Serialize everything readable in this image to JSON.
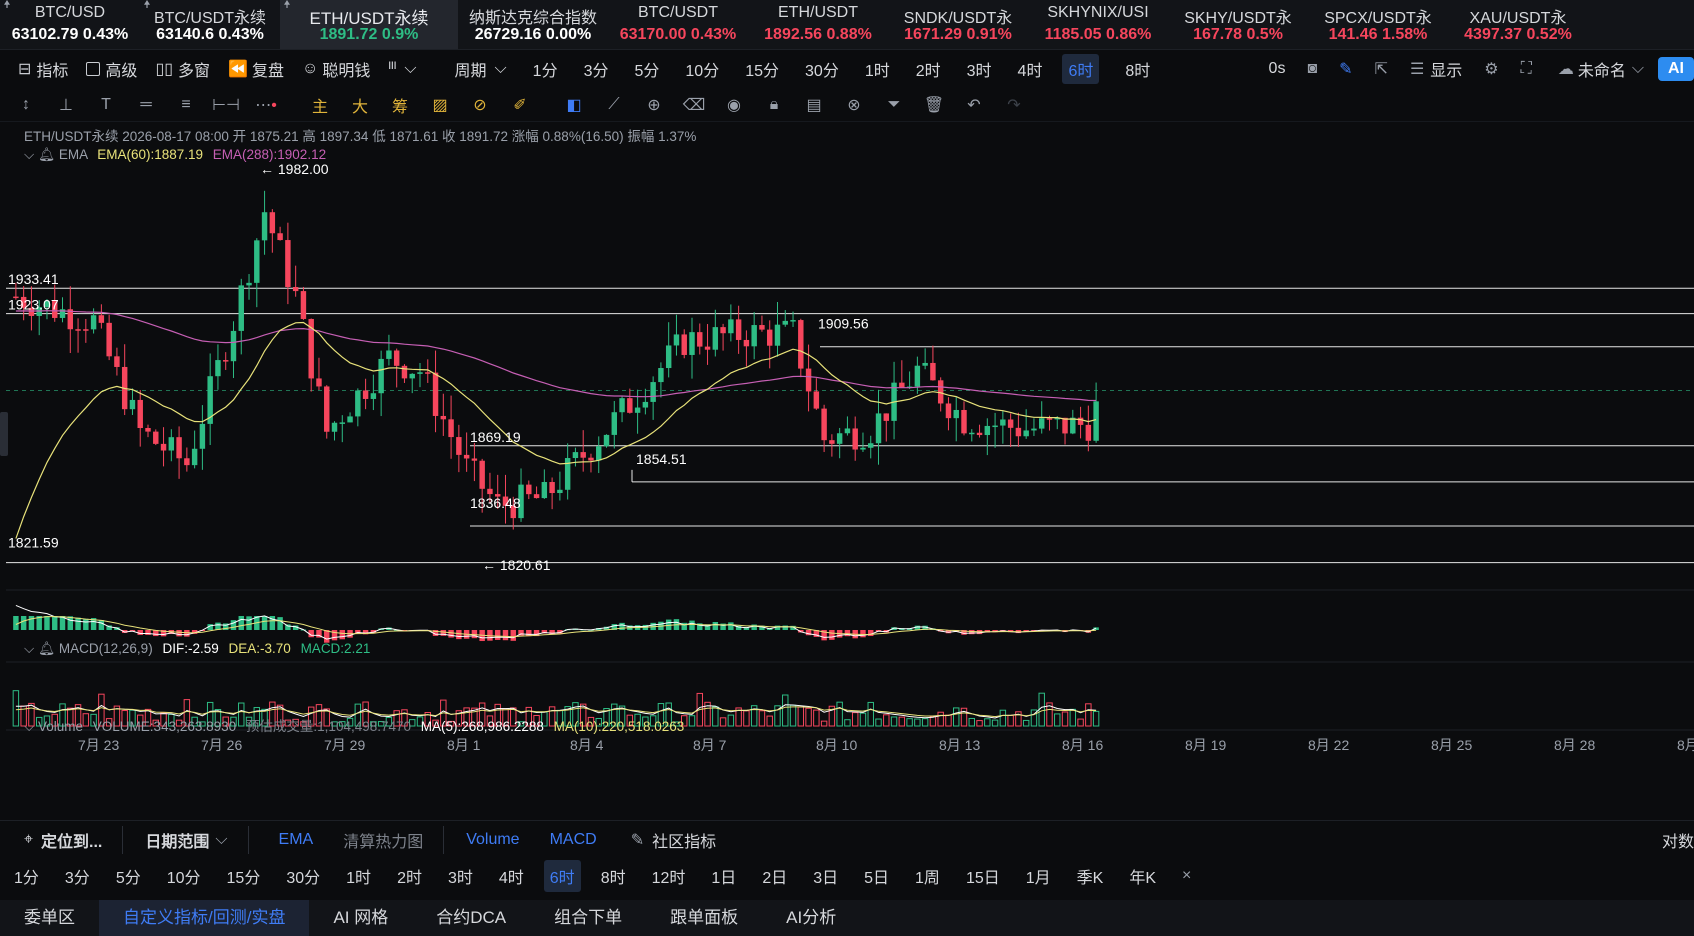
{
  "tickers": [
    {
      "name": "BTC/USD",
      "price": "63102.79",
      "change": "0.43%",
      "color": "#ffffff"
    },
    {
      "name": "BTC/USDT永续",
      "price": "63140.6",
      "change": "0.43%",
      "color": "#ffffff"
    },
    {
      "name": "ETH/USDT永续",
      "price": "1891.72",
      "change": "0.9%",
      "color": "#2ebd85",
      "active": true
    },
    {
      "name": "纳斯达克综合指数",
      "price": "26729.16",
      "change": "0.00%",
      "color": "#ffffff"
    },
    {
      "name": "BTC/USDT",
      "price": "63170.00",
      "change": "0.43%",
      "color": "#f6465d"
    },
    {
      "name": "ETH/USDT",
      "price": "1892.56",
      "change": "0.88%",
      "color": "#f6465d"
    },
    {
      "name": "SNDK/USDT永",
      "price": "1671.29",
      "change": "0.91%",
      "color": "#f6465d"
    },
    {
      "name": "SKHYNIX/USI",
      "price": "1185.05",
      "change": "0.86%",
      "color": "#f6465d"
    },
    {
      "name": "SKHY/USDT永",
      "price": "167.78",
      "change": "0.5%",
      "color": "#f6465d"
    },
    {
      "name": "SPCX/USDT永",
      "price": "141.46",
      "change": "1.58%",
      "color": "#f6465d"
    },
    {
      "name": "XAU/USDT永",
      "price": "4397.37",
      "change": "0.52%",
      "color": "#f6465d"
    }
  ],
  "toolbar": {
    "indicators": "指标",
    "advanced": "高级",
    "multi_window": "多窗",
    "replay": "复盘",
    "smart_money": "聪明钱",
    "layout_icon": "ᴵᴵᴵ",
    "cycle": "周期",
    "periods": [
      "1分",
      "3分",
      "5分",
      "10分",
      "15分",
      "30分",
      "1时",
      "2时",
      "3时",
      "4时",
      "6时",
      "8时"
    ],
    "active_period": "6时",
    "countdown": "0s",
    "display": "显示",
    "unnamed": "未命名",
    "ai": "AI"
  },
  "legend": {
    "symbol_line": "ETH/USDT永续  2026-08-17 08:00  开 1875.21  高 1897.34  低 1871.61  收 1891.72  涨幅 0.88%(16.50)  振幅 1.37%",
    "ema_label": "EMA",
    "ema60": "EMA(60):1887.19",
    "ema288": "EMA(288):1902.12",
    "macd_label": "MACD(12,26,9)",
    "dif": "DIF:-2.59",
    "dea": "DEA:-3.70",
    "macd": "MACD:2.21",
    "volume_label": "Volume",
    "volume": "VOLUME:343,263.8930",
    "est_volume": "预估成交量:1,104,498.7470",
    "ma5": "MA(5):268,986.2288",
    "ma10": "MA(10):220,518.0263"
  },
  "price_labels": [
    "1982.00",
    "1933.41",
    "1923.07",
    "1909.56",
    "1869.19",
    "1854.51",
    "1836.48",
    "1821.59",
    "1820.61"
  ],
  "date_labels": [
    "7月 23",
    "7月 26",
    "7月 29",
    "8月 1",
    "8月 4",
    "8月 7",
    "8月 10",
    "8月 13",
    "8月 16",
    "8月 19",
    "8月 22",
    "8月 25",
    "8月 28",
    "8月"
  ],
  "bottom1": {
    "locate": "定位到...",
    "date_range": "日期范围",
    "ema": "EMA",
    "heatmap": "清算热力图",
    "volume": "Volume",
    "macd": "MACD",
    "community": "社区指标",
    "right": "对数"
  },
  "bottom2": {
    "periods": [
      "1分",
      "3分",
      "5分",
      "10分",
      "15分",
      "30分",
      "1时",
      "2时",
      "3时",
      "4时",
      "6时",
      "8时",
      "12时",
      "1日",
      "2日",
      "3日",
      "5日",
      "1周",
      "15日",
      "1月",
      "季K",
      "年K"
    ],
    "active": "6时",
    "close": "×"
  },
  "bottom3": {
    "tabs": [
      "委单区",
      "自定义指标/回测/实盘",
      "AI 网格",
      "合约DCA",
      "组合下单",
      "跟单面板",
      "AI分析"
    ],
    "active": "自定义指标/回测/实盘"
  },
  "colors": {
    "up": "#2ebd85",
    "down": "#f6465d",
    "ema60": "#e8e27a",
    "ema288": "#c65fb4",
    "accent": "#3f7cf5"
  }
}
